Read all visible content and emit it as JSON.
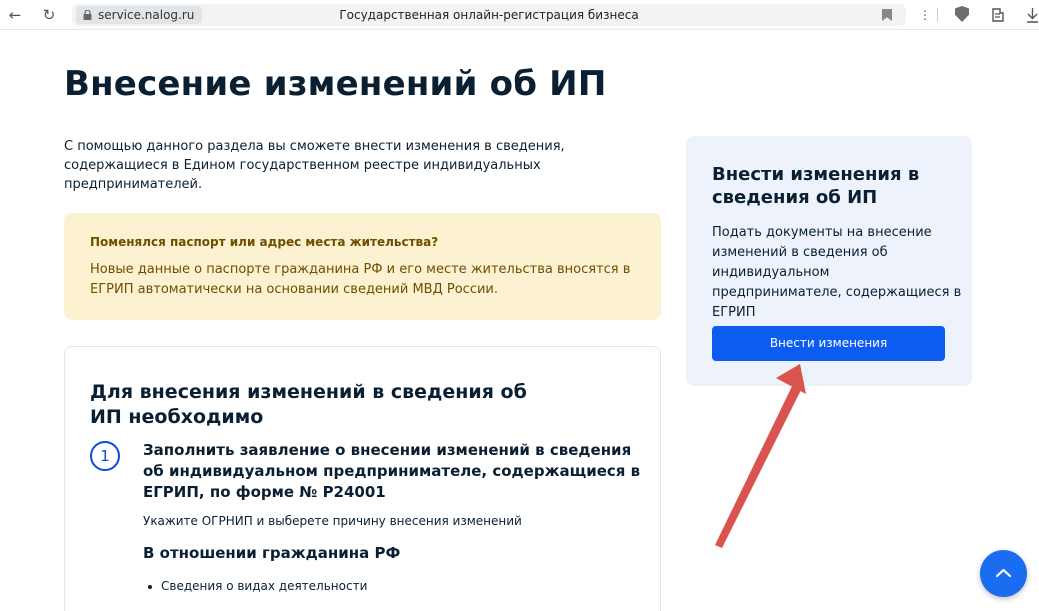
{
  "browser": {
    "domain": "service.nalog.ru",
    "tab_title": "Государственная онлайн-регистрация бизнеса",
    "icons": [
      "back-icon",
      "reload-icon",
      "lock-icon",
      "bookmark-icon",
      "menu-dots-icon",
      "shield-icon",
      "extension-icon",
      "download-icon"
    ]
  },
  "page": {
    "title": "Внесение изменений об ИП",
    "intro": "С помощью данного раздела вы сможете внести изменения в сведения, содержащиеся в Едином государственном реестре индивидуальных предпринимателей."
  },
  "notice": {
    "heading": "Поменялся паспорт или адрес места жительства?",
    "text": "Новые данные о паспорте гражданина РФ и его месте жительства вносятся в ЕГРИП автоматически на основании сведений МВД России."
  },
  "steps_card": {
    "heading": "Для внесения изменений в сведения об ИП необходимо",
    "step1": {
      "number": "1",
      "title": "Заполнить заявление о внесении изменений в сведения об индивидуальном предпринимателе, содержащиеся в ЕГРИП, по форме № Р24001",
      "text": "Укажите ОГРНИП и выберете причину внесения изменений"
    },
    "subheading": "В отношении гражданина РФ",
    "bullets": [
      "Сведения о видах деятельности"
    ]
  },
  "side_panel": {
    "heading": "Внести изменения в сведения об ИП",
    "text": "Подать документы на внесение изменений в сведения об индивидуальном предпринимателе, содержащиеся в ЕГРИП",
    "button_label": "Внести изменения"
  },
  "colors": {
    "accent": "#0d5cf0",
    "notice_bg": "#fcf1d0",
    "notice_text": "#6f4e00",
    "side_bg": "#eef3fb",
    "annotation_arrow": "#d9534f"
  }
}
